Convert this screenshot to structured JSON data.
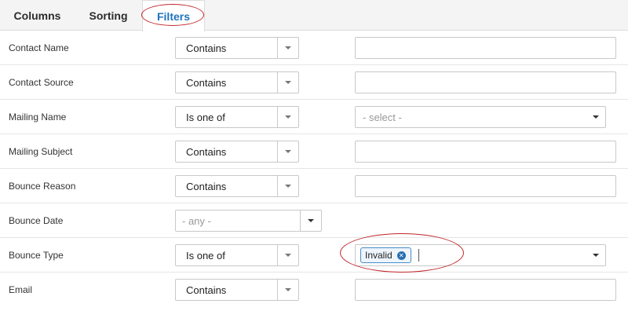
{
  "tabs": [
    {
      "label": "Columns"
    },
    {
      "label": "Sorting"
    },
    {
      "label": "Filters"
    }
  ],
  "active_tab": "Filters",
  "filters": [
    {
      "label": "Contact Name",
      "operator": "Contains",
      "value": ""
    },
    {
      "label": "Contact Source",
      "operator": "Contains",
      "value": ""
    },
    {
      "label": "Mailing Name",
      "operator": "Is one of",
      "select_placeholder": "- select -"
    },
    {
      "label": "Mailing Subject",
      "operator": "Contains",
      "value": ""
    },
    {
      "label": "Bounce Reason",
      "operator": "Contains",
      "value": ""
    },
    {
      "label": "Bounce Date",
      "date_option": "- any -"
    },
    {
      "label": "Bounce Type",
      "operator": "Is one of",
      "selected_chips": [
        "Invalid"
      ]
    },
    {
      "label": "Email",
      "operator": "Contains",
      "value": ""
    }
  ],
  "colors": {
    "active_tab_text": "#1e73be",
    "annotation": "#c0262b",
    "chip_border": "#4a8cc7"
  }
}
